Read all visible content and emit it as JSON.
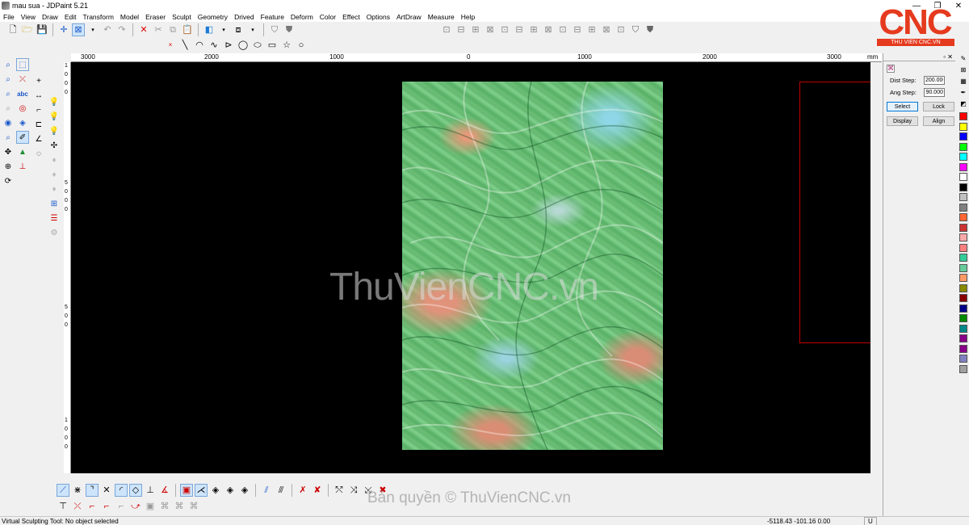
{
  "window": {
    "title": "mau sua - JDPaint 5.21",
    "minimize": "—",
    "maximize": "❐",
    "close": "✕"
  },
  "menu": [
    "File",
    "View",
    "Draw",
    "Edit",
    "Transform",
    "Model",
    "Eraser",
    "Sculpt",
    "Geometry",
    "Drived",
    "Feature",
    "Deform",
    "Color",
    "Effect",
    "Options",
    "ArtDraw",
    "Measure",
    "Help"
  ],
  "ruler": {
    "h_labels": [
      "3000",
      "2000",
      "1000",
      "0",
      "1000",
      "2000",
      "3000"
    ],
    "unit": "mm",
    "v_labels": [
      "1",
      "0",
      "0",
      "0",
      "5",
      "0",
      "0",
      "0",
      "5",
      "0",
      "0",
      "1",
      "0",
      "0",
      "0"
    ]
  },
  "panel": {
    "dist_step_label": "Dist Step:",
    "dist_step_value": "200.000",
    "ang_step_label": "Ang Step:",
    "ang_step_value": "90.000",
    "select_label": "Select",
    "lock_label": "Lock",
    "display_label": "Display",
    "align_label": "Align"
  },
  "palette": [
    "#ff0000",
    "#ffff00",
    "#0000ff",
    "#00ff00",
    "#00ffff",
    "#ff00ff",
    "#ffffff",
    "#000000",
    "#c0c0c0",
    "#808080",
    "#ff6633",
    "#cc3333",
    "#ffaaaa",
    "#ff8080",
    "#33cc99",
    "#66cc99",
    "#ff9966",
    "#888800",
    "#880000",
    "#000088",
    "#008800",
    "#008888",
    "#880088",
    "#880088",
    "#8080c0",
    "#a0a0a0"
  ],
  "watermark": "ThuVienCNC.vn",
  "copyright": "Bản quyền © ThuVienCNC.vn",
  "logo": {
    "text": "CNC",
    "sub": "THU VIEN CNC.VN"
  },
  "status": {
    "text": "Virtual Sculpting Tool: No object selected",
    "coords": "-5118.43 -101.16 0.00",
    "mode": "U"
  }
}
